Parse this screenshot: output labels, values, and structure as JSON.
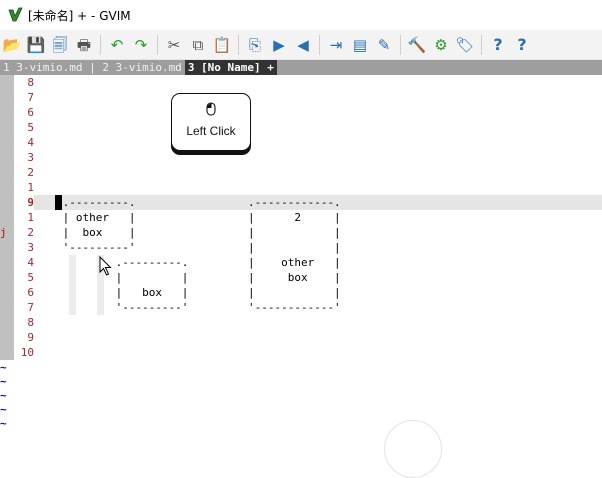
{
  "window": {
    "title": "[未命名] + - GVIM"
  },
  "toolbar": {
    "buttons": [
      {
        "name": "open-icon",
        "glyph": "📂",
        "color": "#d89b2b"
      },
      {
        "name": "save-icon",
        "glyph": "💾",
        "color": "#2a6fb3"
      },
      {
        "name": "save-all-icon",
        "glyph": "🗐",
        "color": "#2a6fb3"
      },
      {
        "name": "print-icon",
        "glyph": "🖶",
        "color": "#555555"
      },
      {
        "sep": true
      },
      {
        "name": "undo-icon",
        "glyph": "↶",
        "color": "#2a9b2a"
      },
      {
        "name": "redo-icon",
        "glyph": "↷",
        "color": "#2a9b2a"
      },
      {
        "sep": true
      },
      {
        "name": "cut-icon",
        "glyph": "✂",
        "color": "#555555"
      },
      {
        "name": "copy-icon",
        "glyph": "⧉",
        "color": "#555555"
      },
      {
        "name": "paste-icon",
        "glyph": "📋",
        "color": "#9a7a3a"
      },
      {
        "sep": true
      },
      {
        "name": "find-replace-icon",
        "glyph": "⎘",
        "color": "#2a6fb3"
      },
      {
        "name": "find-next-icon",
        "glyph": "▶",
        "color": "#2a6fb3"
      },
      {
        "name": "find-prev-icon",
        "glyph": "◀",
        "color": "#2a6fb3"
      },
      {
        "sep": true
      },
      {
        "name": "load-session-icon",
        "glyph": "⇥",
        "color": "#2a6fb3"
      },
      {
        "name": "save-session-icon",
        "glyph": "▤",
        "color": "#2a6fb3"
      },
      {
        "name": "run-script-icon",
        "glyph": "✎",
        "color": "#2a6fb3"
      },
      {
        "sep": true
      },
      {
        "name": "make-icon",
        "glyph": "🔨",
        "color": "#c07a2a"
      },
      {
        "name": "build-tags-icon",
        "glyph": "⚙",
        "color": "#2a9b2a"
      },
      {
        "name": "jump-tag-icon",
        "glyph": "🏷",
        "color": "#2a6fb3"
      },
      {
        "sep": true
      },
      {
        "name": "help-icon",
        "glyph": "?",
        "color": "#2a6fb3"
      },
      {
        "name": "find-help-icon",
        "glyph": "?",
        "color": "#2a6fb3"
      }
    ]
  },
  "tabs": [
    {
      "label": "1 3-vimio.md | 2 3-vimio.md",
      "active": false
    },
    {
      "label": "3 [No Name] +",
      "active": true
    }
  ],
  "editor": {
    "line_numbers": [
      "8",
      "7",
      "6",
      "5",
      "4",
      "3",
      "2",
      "1",
      "9",
      "1",
      "2",
      "3",
      "4",
      "5",
      "6",
      "7",
      "8",
      "9",
      "10"
    ],
    "current_line_index": 8,
    "sign_mark": "j",
    "lines": [
      {
        "row": 8,
        "col": 1,
        "text": ".---------."
      },
      {
        "row": 9,
        "col": 1,
        "text": "| other   |"
      },
      {
        "row": 10,
        "col": 1,
        "text": "|  box    |"
      },
      {
        "row": 11,
        "col": 1,
        "text": "'---------'"
      },
      {
        "row": 12,
        "col": 9,
        "text": ".---------."
      },
      {
        "row": 13,
        "col": 9,
        "text": "|         |"
      },
      {
        "row": 14,
        "col": 9,
        "text": "|   box   |"
      },
      {
        "row": 15,
        "col": 9,
        "text": "'---------'"
      },
      {
        "row": 8,
        "col": 29,
        "text": ".------------."
      },
      {
        "row": 9,
        "col": 29,
        "text": "|      2     |"
      },
      {
        "row": 10,
        "col": 29,
        "text": "|            |"
      },
      {
        "row": 11,
        "col": 29,
        "text": "|            |"
      },
      {
        "row": 12,
        "col": 29,
        "text": "|    other   |"
      },
      {
        "row": 13,
        "col": 29,
        "text": "|     box    |"
      },
      {
        "row": 14,
        "col": 29,
        "text": "|            |"
      },
      {
        "row": 15,
        "col": 29,
        "text": "'------------'"
      }
    ],
    "tildes": [
      "~",
      "~",
      "~",
      "~",
      "~"
    ]
  },
  "click_overlay": {
    "label": "Left Click"
  }
}
